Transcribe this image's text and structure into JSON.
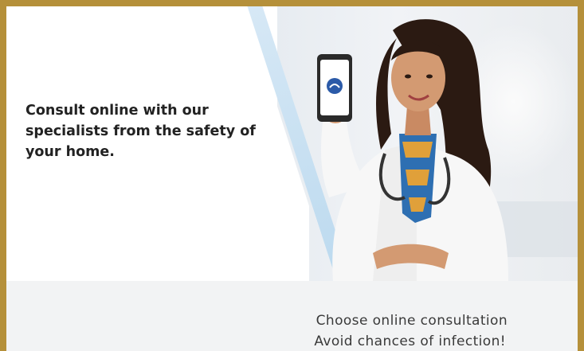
{
  "banner": {
    "headline": "Consult online with our specialists from the safety of your home.",
    "footer_line_1": "Choose online consultation",
    "footer_line_2": "Avoid chances of infection!"
  },
  "icons": {
    "phone_app_icon": "telehealth-app-logo-icon"
  },
  "colors": {
    "frame": "#b5903a",
    "accent_stripe": "#b9d8ee",
    "footer_bg": "#f2f3f4",
    "headline_text": "#222222"
  }
}
